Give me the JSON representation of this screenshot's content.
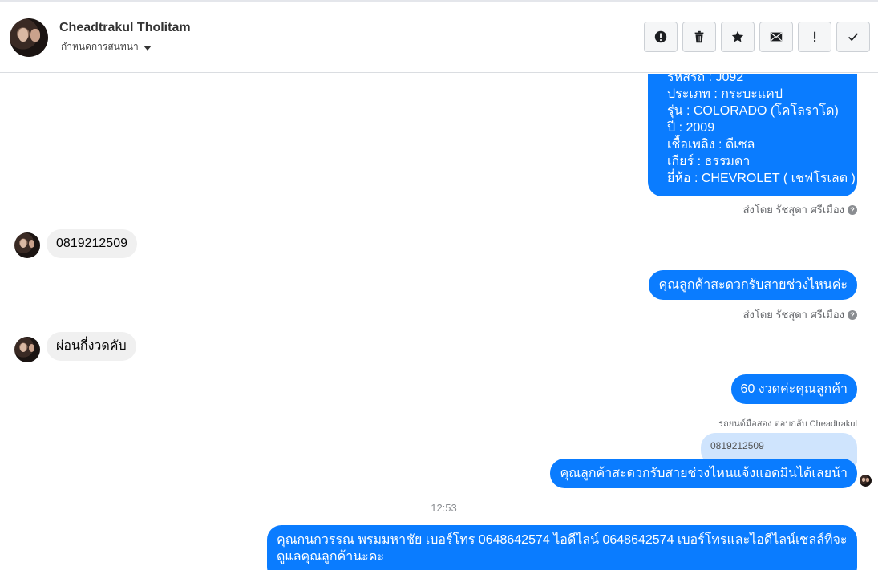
{
  "header": {
    "name": "Cheadtrakul Tholitam",
    "subtitle": "กำหนดการสนทนา",
    "tools": [
      "report-icon",
      "trash-icon",
      "star-icon",
      "mail-icon",
      "exclamation-icon",
      "check-icon"
    ]
  },
  "messages": {
    "car_lines": [
      "รหัสรถ : J092",
      "ประเภท : กระบะแคป",
      "รุ่น : COLORADO (โคโลราโด)",
      "ปี : 2009",
      "เชื้อเพลิง : ดีเซล",
      "เกียร์ : ธรรมดา",
      "ยี่ห้อ : CHEVROLET ( เชฟโรเลต )"
    ],
    "sent_by_1": "ส่งโดย รัชสุดา ศรีเมือง",
    "in_phone": "0819212509",
    "out_ask": "คุณลูกค้าสะดวกรับสายช่วงไหนค่ะ",
    "sent_by_2": "ส่งโดย รัชสุดา ศรีเมือง",
    "in_install": "ผ่อนกี่งวดคับ",
    "out_60": "60  งวดค่ะคุณลูกค้า",
    "reply_note": "รถยนต์มือสอง ตอบกลับ Cheadtrakul",
    "reply_quote": "0819212509",
    "out_ask2": "คุณลูกค้าสะดวกรับสายช่วงไหนแจ้งแอดมินได้เลยน้า",
    "time": "12:53",
    "out_long": "คุณกนกวรรณ พรมมหาชัย      เบอร์โทร 0648642574  ไอดีไลน์ 0648642574   เบอร์โทรและไอดีไลน์เซลล์ที่จะดูแลคุณลูกค้านะคะ"
  },
  "colors": {
    "outgoing": "#0a7cff",
    "incoming": "#f0f0f0"
  }
}
